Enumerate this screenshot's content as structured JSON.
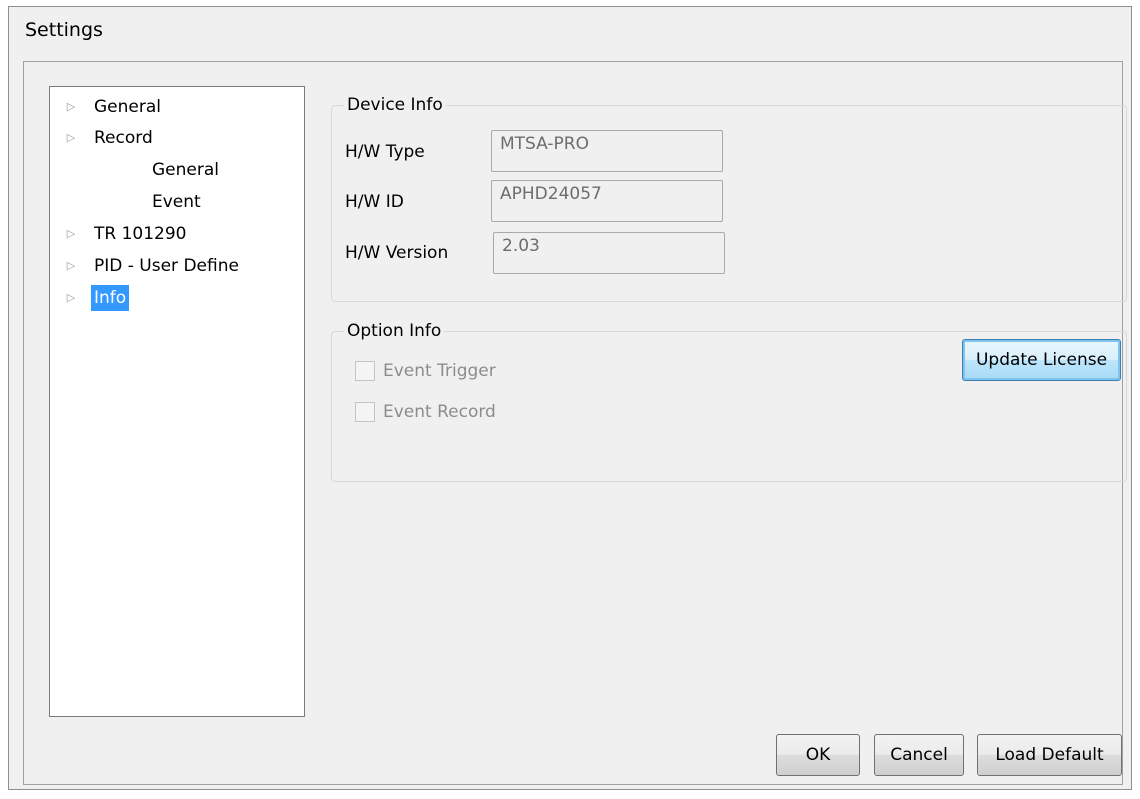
{
  "window": {
    "title": "Settings"
  },
  "tree": {
    "items": [
      {
        "label": "General",
        "expandable": true
      },
      {
        "label": "Record",
        "expandable": true,
        "children": [
          "General",
          "Event"
        ]
      },
      {
        "label": "TR 101290",
        "expandable": true
      },
      {
        "label": "PID - User Define",
        "expandable": true
      },
      {
        "label": "Info",
        "expandable": true,
        "selected": true
      }
    ]
  },
  "device_info": {
    "title": "Device Info",
    "hw_type_label": "H/W Type",
    "hw_type_value": "MTSA-PRO",
    "hw_id_label": "H/W ID",
    "hw_id_value": "APHD24057",
    "hw_version_label": "H/W Version",
    "hw_version_value": "2.03"
  },
  "option_info": {
    "title": "Option Info",
    "event_trigger_label": "Event Trigger",
    "event_trigger_checked": false,
    "event_record_label": "Event Record",
    "event_record_checked": false,
    "update_license_label": "Update License"
  },
  "footer": {
    "ok_label": "OK",
    "cancel_label": "Cancel",
    "load_default_label": "Load Default"
  },
  "colors": {
    "selection": "#3399ff",
    "window_bg": "#f0f0f0",
    "default_button_border": "#3c7fb1"
  }
}
